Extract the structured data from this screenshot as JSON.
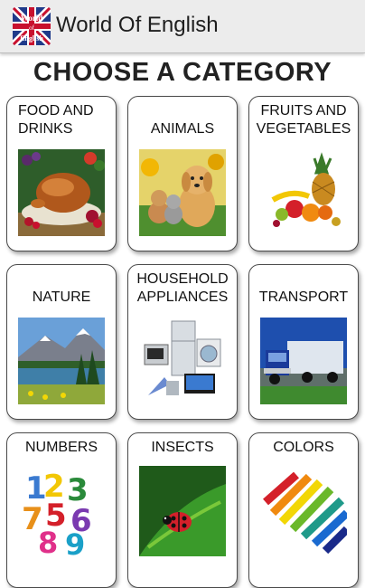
{
  "appbar": {
    "title": "World Of English",
    "icon": "uk-flag-app-icon",
    "icon_text": "World of English"
  },
  "main": {
    "heading": "CHOOSE A CATEGORY",
    "categories": [
      {
        "label": "FOOD AND DRINKS",
        "icon": "roast-turkey-image"
      },
      {
        "label": "ANIMALS",
        "icon": "puppy-kittens-image"
      },
      {
        "label": "FRUITS AND VEGETABLES",
        "icon": "fruits-image"
      },
      {
        "label": "NATURE",
        "icon": "mountain-lake-image"
      },
      {
        "label": "HOUSEHOLD APPLIANCES",
        "icon": "appliances-image"
      },
      {
        "label": "TRANSPORT",
        "icon": "truck-image"
      },
      {
        "label": "NUMBERS",
        "icon": "colorful-numbers-image"
      },
      {
        "label": "INSECTS",
        "icon": "ladybug-image"
      },
      {
        "label": "COLORS",
        "icon": "colored-pencils-image"
      }
    ]
  },
  "colors": {
    "appbar_bg": "#ececec",
    "card_border": "#4a4a4a"
  }
}
